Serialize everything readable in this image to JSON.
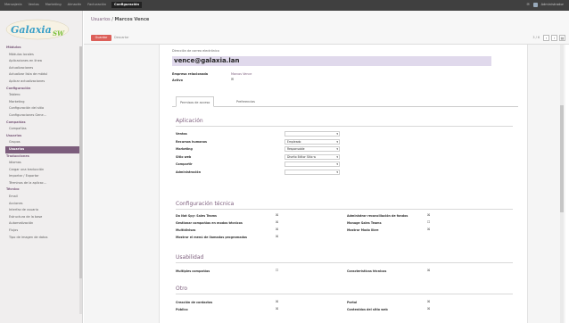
{
  "topbar": {
    "menu": [
      "Mensajería",
      "Ventas",
      "Marketing",
      "Almacén",
      "Facturación"
    ],
    "active": "Configuración",
    "user": "Administrador"
  },
  "sidebar": {
    "logo_text": "Galaxia",
    "logo_suffix": "SW",
    "items": [
      {
        "label": "Módulos",
        "head": true
      },
      {
        "label": "Módulos locales"
      },
      {
        "label": "Aplicaciones en línea"
      },
      {
        "label": "Actualizaciones"
      },
      {
        "label": "Actualizar lista de módul"
      },
      {
        "label": "Aplicar actualizaciones"
      },
      {
        "label": "Configuración",
        "head": true
      },
      {
        "label": "Tablero"
      },
      {
        "label": "Marketing"
      },
      {
        "label": "Configuración del sitio"
      },
      {
        "label": "Configuraciones Gene..."
      },
      {
        "label": "Compañías",
        "head": true
      },
      {
        "label": "Compañías"
      },
      {
        "label": "Usuarios",
        "head": true
      },
      {
        "label": "Grupos"
      },
      {
        "label": "Usuarios",
        "active": true
      },
      {
        "label": "Traducciones",
        "head": true
      },
      {
        "label": "Idiomas"
      },
      {
        "label": "Cargar una traducción"
      },
      {
        "label": "Importar / Exportar"
      },
      {
        "label": "Términos de la aplicac..."
      },
      {
        "label": "Técnico",
        "head": true
      },
      {
        "label": "Email"
      },
      {
        "label": "Acciones"
      },
      {
        "label": "Interfaz de usuario"
      },
      {
        "label": "Estructura de la base"
      },
      {
        "label": "Automatización"
      },
      {
        "label": "Flujos"
      },
      {
        "label": "Tipo de imagen de datos"
      }
    ]
  },
  "header": {
    "breadcrumb_parent": "Usuarios",
    "breadcrumb_current": "Marcos Vence",
    "save_label": "Guardar",
    "discard_label": "Descartar",
    "pager_count": "3 / 6"
  },
  "form": {
    "email_label": "Dirección de correo electrónico",
    "email_value": "vence@galaxia.lan",
    "related_partner_label": "Empresa relacionada",
    "related_partner_value": "Marcos Vence",
    "active_label": "Activo",
    "tabs": [
      "Permisos de acceso",
      "Preferencias"
    ],
    "sections": {
      "application_title": "Aplicación",
      "tech_title": "Configuración técnica",
      "usability_title": "Usabilidad",
      "other_title": "Otro"
    },
    "application_rows": [
      {
        "label": "Ventas",
        "value": ""
      },
      {
        "label": "Recursos humanos",
        "value": "Empleado"
      },
      {
        "label": "Marketing",
        "value": "Responsable"
      },
      {
        "label": "Sitio web",
        "value": "Diseño Editor Sitio w"
      },
      {
        "label": "Compartir",
        "value": ""
      },
      {
        "label": "Administración",
        "value": ""
      }
    ],
    "tech_rows": [
      {
        "left": "Do Not Spy: Sales Teams",
        "left_check": "☒",
        "right": "Administrar reconciliación de fondos",
        "right_check": "☒"
      },
      {
        "left": "Gestionar compañías en modos técnicos",
        "left_check": "☒",
        "right": "Manage Sales Teams",
        "right_check": "☐"
      },
      {
        "left": "Multidivisas",
        "left_check": "☒",
        "right": "Mostrar Modo libre",
        "right_check": "☒"
      },
      {
        "left": "Mostrar el menú de llamadas programadas",
        "left_check": "☒",
        "right": "",
        "right_check": ""
      }
    ],
    "usability_rows": [
      {
        "left": "Multiples compañías",
        "left_check": "☐",
        "right": "Características técnicas",
        "right_check": "☒"
      }
    ],
    "other_rows": [
      {
        "left": "Creación de contactos",
        "left_check": "☒",
        "right": "Portal",
        "right_check": "☒"
      },
      {
        "left": "Público",
        "left_check": "☒",
        "right": "Contenidos del sitio web",
        "right_check": "☒"
      }
    ]
  }
}
